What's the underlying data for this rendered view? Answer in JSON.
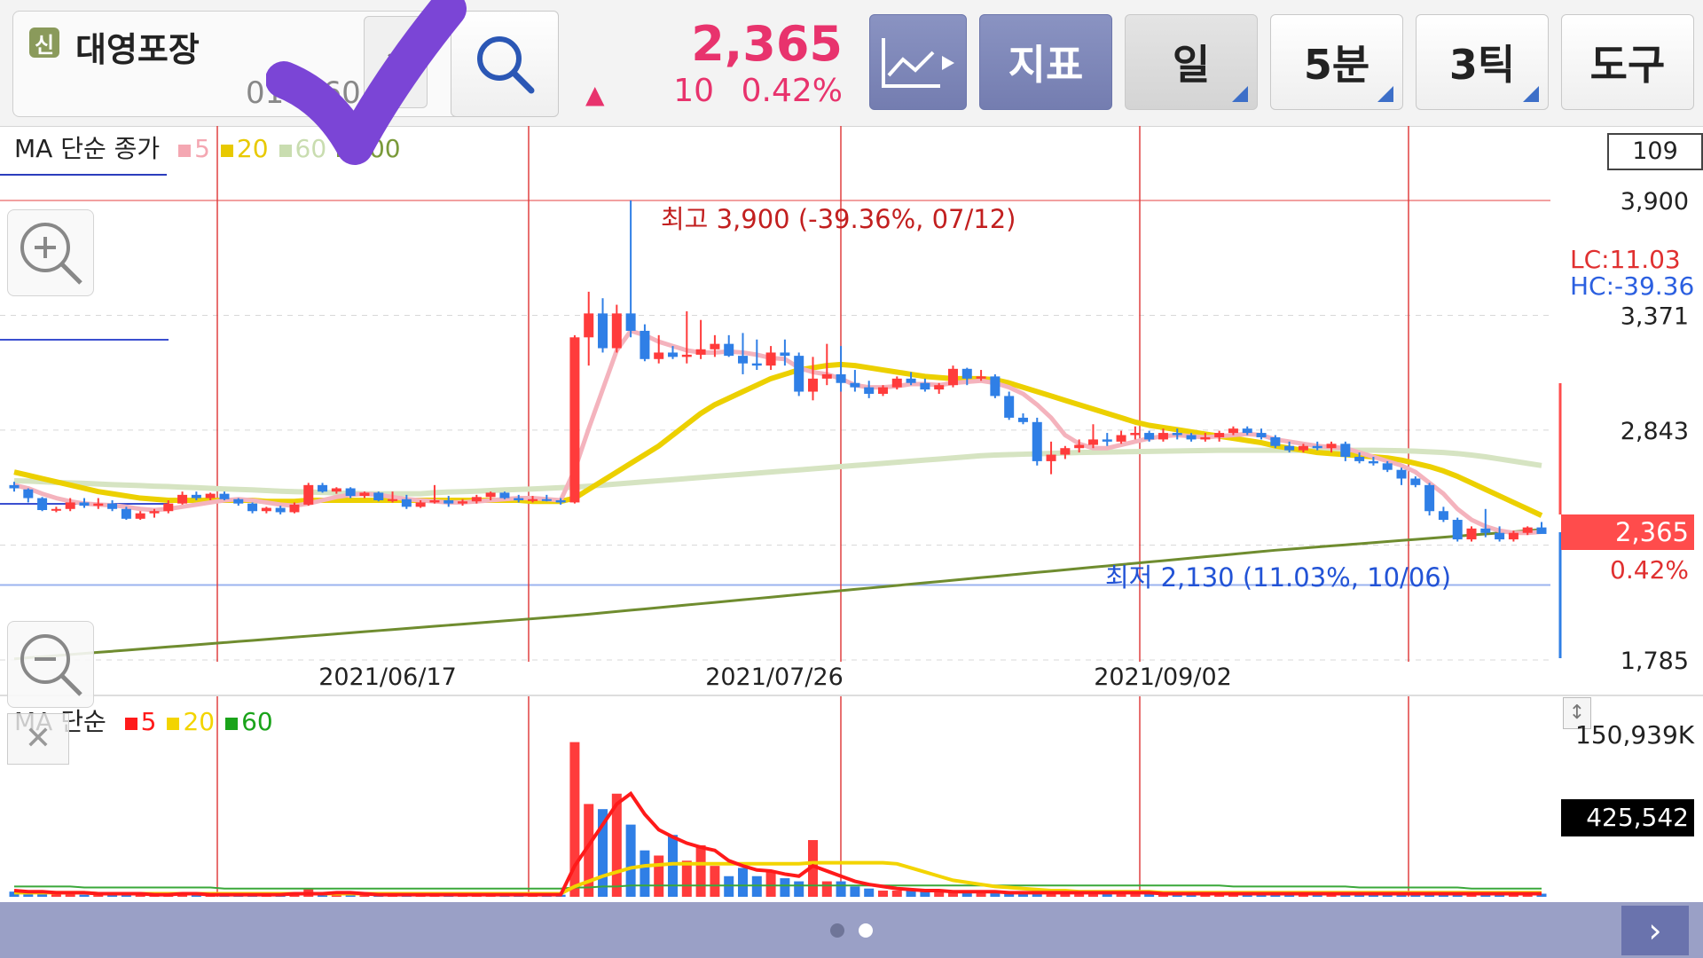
{
  "toolbar": {
    "credit_badge": "신",
    "stock_name": "대영포장",
    "stock_code": "014160",
    "price": "2,365",
    "change_arrow": "▲",
    "change_value": "10",
    "change_percent": "0.42%",
    "buttons": {
      "chart_type": "",
      "indicator": "지표",
      "period_day": "일",
      "period_5min": "5분",
      "period_3tick": "3틱",
      "tools": "도구"
    }
  },
  "main_chart": {
    "legend_title": "MA 단순 종가",
    "legend_items": [
      {
        "label": "5",
        "color": "#f4a7b2"
      },
      {
        "label": "20",
        "color": "#e8c900"
      },
      {
        "label": "60",
        "color": "#c9ddb0"
      },
      {
        "label": "200",
        "color": "#7a9a3a"
      }
    ],
    "count_box": "109",
    "y_ticks": [
      "3,900",
      "3,371",
      "2,843",
      "1,785"
    ],
    "lc_label": "LC:11.03",
    "hc_label": "HC:-39.36",
    "current_price_tag": "2,365",
    "current_pct": "0.42%",
    "high_annotation": "최고 3,900 (-39.36%, 07/12)",
    "low_annotation": "최저 2,130 (11.03%, 10/06)",
    "x_ticks": [
      "2021/06/17",
      "2021/07/26",
      "2021/09/02"
    ]
  },
  "volume_chart": {
    "legend_title": "MA 단순",
    "legend_items": [
      {
        "label": "5",
        "color": "#ff1a1a"
      },
      {
        "label": "20",
        "color": "#f3d400"
      },
      {
        "label": "60",
        "color": "#1aa31a"
      }
    ],
    "max_label": "150,939K",
    "current_volume": "425,542"
  },
  "chart_data": {
    "type": "candlestick",
    "y_range": [
      1785,
      3900
    ],
    "price_high": 3900,
    "price_low": 2130,
    "current": 2365,
    "x_tick_dates": [
      "2021/06/17",
      "2021/07/26",
      "2021/09/02"
    ],
    "candles": [
      [
        2590,
        2605,
        2560,
        2575
      ],
      [
        2570,
        2575,
        2510,
        2530
      ],
      [
        2530,
        2535,
        2470,
        2475
      ],
      [
        2475,
        2490,
        2465,
        2480
      ],
      [
        2480,
        2530,
        2470,
        2510
      ],
      [
        2510,
        2530,
        2485,
        2495
      ],
      [
        2495,
        2530,
        2480,
        2505
      ],
      [
        2505,
        2520,
        2470,
        2480
      ],
      [
        2480,
        2490,
        2430,
        2435
      ],
      [
        2435,
        2470,
        2430,
        2460
      ],
      [
        2460,
        2480,
        2440,
        2470
      ],
      [
        2470,
        2520,
        2460,
        2505
      ],
      [
        2505,
        2560,
        2500,
        2545
      ],
      [
        2545,
        2560,
        2520,
        2530
      ],
      [
        2530,
        2555,
        2520,
        2550
      ],
      [
        2550,
        2560,
        2520,
        2525
      ],
      [
        2525,
        2530,
        2495,
        2505
      ],
      [
        2505,
        2510,
        2460,
        2470
      ],
      [
        2470,
        2490,
        2460,
        2485
      ],
      [
        2485,
        2495,
        2455,
        2465
      ],
      [
        2465,
        2510,
        2460,
        2500
      ],
      [
        2500,
        2600,
        2495,
        2590
      ],
      [
        2590,
        2600,
        2555,
        2560
      ],
      [
        2560,
        2580,
        2550,
        2575
      ],
      [
        2575,
        2580,
        2530,
        2540
      ],
      [
        2540,
        2560,
        2530,
        2555
      ],
      [
        2555,
        2560,
        2515,
        2520
      ],
      [
        2520,
        2560,
        2510,
        2525
      ],
      [
        2525,
        2545,
        2480,
        2490
      ],
      [
        2490,
        2520,
        2485,
        2510
      ],
      [
        2510,
        2590,
        2505,
        2520
      ],
      [
        2520,
        2540,
        2490,
        2505
      ],
      [
        2505,
        2525,
        2495,
        2515
      ],
      [
        2515,
        2545,
        2505,
        2535
      ],
      [
        2535,
        2560,
        2520,
        2555
      ],
      [
        2555,
        2560,
        2525,
        2530
      ],
      [
        2530,
        2545,
        2510,
        2520
      ],
      [
        2520,
        2540,
        2510,
        2525
      ],
      [
        2525,
        2545,
        2515,
        2520
      ],
      [
        2520,
        2530,
        2500,
        2510
      ],
      [
        2510,
        3280,
        2505,
        3270
      ],
      [
        3270,
        3480,
        3140,
        3380
      ],
      [
        3380,
        3450,
        3200,
        3220
      ],
      [
        3220,
        3420,
        3200,
        3380
      ],
      [
        3380,
        3900,
        3270,
        3300
      ],
      [
        3300,
        3330,
        3160,
        3170
      ],
      [
        3170,
        3280,
        3150,
        3200
      ],
      [
        3200,
        3230,
        3170,
        3180
      ],
      [
        3180,
        3390,
        3150,
        3190
      ],
      [
        3190,
        3350,
        3170,
        3215
      ],
      [
        3215,
        3280,
        3180,
        3240
      ],
      [
        3240,
        3280,
        3180,
        3185
      ],
      [
        3185,
        3290,
        3100,
        3150
      ],
      [
        3150,
        3260,
        3120,
        3140
      ],
      [
        3140,
        3230,
        3120,
        3200
      ],
      [
        3200,
        3260,
        3140,
        3185
      ],
      [
        3185,
        3200,
        3000,
        3020
      ],
      [
        3020,
        3180,
        2980,
        3080
      ],
      [
        3080,
        3240,
        3050,
        3100
      ],
      [
        3100,
        3230,
        3020,
        3060
      ],
      [
        3060,
        3120,
        3020,
        3040
      ],
      [
        3040,
        3070,
        2990,
        3010
      ],
      [
        3010,
        3050,
        3000,
        3040
      ],
      [
        3040,
        3090,
        3030,
        3080
      ],
      [
        3080,
        3110,
        3050,
        3060
      ],
      [
        3060,
        3080,
        3020,
        3030
      ],
      [
        3030,
        3060,
        3010,
        3050
      ],
      [
        3050,
        3140,
        3040,
        3125
      ],
      [
        3125,
        3130,
        3050,
        3080
      ],
      [
        3080,
        3120,
        3070,
        3090
      ],
      [
        3090,
        3100,
        2990,
        3000
      ],
      [
        3000,
        3020,
        2890,
        2900
      ],
      [
        2900,
        2920,
        2870,
        2880
      ],
      [
        2880,
        2900,
        2680,
        2700
      ],
      [
        2700,
        2790,
        2640,
        2730
      ],
      [
        2730,
        2770,
        2710,
        2760
      ],
      [
        2760,
        2800,
        2740,
        2775
      ],
      [
        2775,
        2870,
        2760,
        2800
      ],
      [
        2800,
        2830,
        2770,
        2790
      ],
      [
        2790,
        2840,
        2780,
        2820
      ],
      [
        2820,
        2860,
        2800,
        2830
      ],
      [
        2830,
        2840,
        2790,
        2800
      ],
      [
        2800,
        2850,
        2790,
        2830
      ],
      [
        2830,
        2850,
        2800,
        2820
      ],
      [
        2820,
        2830,
        2790,
        2800
      ],
      [
        2800,
        2830,
        2790,
        2810
      ],
      [
        2810,
        2840,
        2790,
        2830
      ],
      [
        2830,
        2860,
        2820,
        2850
      ],
      [
        2850,
        2860,
        2820,
        2830
      ],
      [
        2830,
        2850,
        2800,
        2810
      ],
      [
        2810,
        2820,
        2760,
        2770
      ],
      [
        2770,
        2790,
        2740,
        2750
      ],
      [
        2750,
        2780,
        2740,
        2770
      ],
      [
        2770,
        2790,
        2750,
        2760
      ],
      [
        2760,
        2790,
        2740,
        2780
      ],
      [
        2780,
        2790,
        2700,
        2720
      ],
      [
        2720,
        2740,
        2690,
        2700
      ],
      [
        2700,
        2720,
        2680,
        2690
      ],
      [
        2690,
        2700,
        2650,
        2660
      ],
      [
        2660,
        2670,
        2590,
        2620
      ],
      [
        2620,
        2630,
        2580,
        2590
      ],
      [
        2590,
        2600,
        2450,
        2470
      ],
      [
        2470,
        2490,
        2420,
        2430
      ],
      [
        2430,
        2440,
        2330,
        2340
      ],
      [
        2340,
        2400,
        2330,
        2390
      ],
      [
        2390,
        2480,
        2350,
        2370
      ],
      [
        2370,
        2400,
        2330,
        2340
      ],
      [
        2340,
        2380,
        2330,
        2370
      ],
      [
        2370,
        2400,
        2360,
        2395
      ],
      [
        2395,
        2420,
        2370,
        2365
      ]
    ],
    "ma5": [
      2590,
      2575,
      2550,
      2530,
      2515,
      2505,
      2500,
      2497,
      2490,
      2480,
      2475,
      2480,
      2490,
      2500,
      2510,
      2520,
      2525,
      2520,
      2510,
      2500,
      2495,
      2505,
      2520,
      2535,
      2545,
      2550,
      2545,
      2535,
      2525,
      2520,
      2515,
      2510,
      2510,
      2515,
      2520,
      2525,
      2530,
      2530,
      2525,
      2520,
      2660,
      2850,
      3030,
      3210,
      3300,
      3280,
      3250,
      3230,
      3210,
      3200,
      3200,
      3205,
      3200,
      3190,
      3175,
      3170,
      3130,
      3110,
      3100,
      3080,
      3050,
      3040,
      3040,
      3045,
      3055,
      3055,
      3050,
      3060,
      3065,
      3070,
      3060,
      3040,
      3010,
      2960,
      2900,
      2820,
      2780,
      2760,
      2760,
      2775,
      2790,
      2805,
      2815,
      2820,
      2815,
      2810,
      2815,
      2820,
      2825,
      2820,
      2800,
      2790,
      2780,
      2770,
      2765,
      2760,
      2740,
      2720,
      2700,
      2680,
      2650,
      2600,
      2550,
      2480,
      2430,
      2400,
      2380,
      2370,
      2370,
      2375
    ],
    "ma20": [
      2650,
      2635,
      2620,
      2605,
      2590,
      2575,
      2560,
      2550,
      2540,
      2530,
      2525,
      2520,
      2520,
      2520,
      2520,
      2520,
      2520,
      2520,
      2515,
      2515,
      2515,
      2520,
      2520,
      2520,
      2520,
      2520,
      2520,
      2520,
      2520,
      2520,
      2520,
      2520,
      2520,
      2520,
      2520,
      2520,
      2520,
      2515,
      2515,
      2515,
      2530,
      2570,
      2610,
      2650,
      2690,
      2730,
      2770,
      2820,
      2870,
      2920,
      2960,
      2990,
      3020,
      3050,
      3080,
      3100,
      3120,
      3130,
      3140,
      3145,
      3140,
      3130,
      3120,
      3110,
      3100,
      3090,
      3085,
      3080,
      3080,
      3080,
      3075,
      3060,
      3040,
      3020,
      3000,
      2980,
      2960,
      2940,
      2920,
      2900,
      2880,
      2865,
      2855,
      2845,
      2835,
      2825,
      2815,
      2805,
      2795,
      2785,
      2770,
      2760,
      2750,
      2740,
      2735,
      2730,
      2725,
      2720,
      2715,
      2705,
      2690,
      2675,
      2655,
      2630,
      2600,
      2570,
      2540,
      2510,
      2480,
      2450
    ],
    "ma60": [
      2610,
      2608,
      2605,
      2602,
      2600,
      2598,
      2595,
      2592,
      2590,
      2588,
      2585,
      2583,
      2580,
      2578,
      2575,
      2572,
      2570,
      2568,
      2565,
      2562,
      2560,
      2558,
      2556,
      2554,
      2552,
      2550,
      2550,
      2550,
      2550,
      2550,
      2555,
      2558,
      2560,
      2562,
      2565,
      2568,
      2570,
      2572,
      2575,
      2578,
      2580,
      2585,
      2590,
      2595,
      2600,
      2605,
      2610,
      2615,
      2620,
      2625,
      2630,
      2635,
      2640,
      2645,
      2650,
      2655,
      2660,
      2665,
      2670,
      2675,
      2680,
      2685,
      2690,
      2695,
      2700,
      2705,
      2710,
      2715,
      2720,
      2725,
      2728,
      2730,
      2732,
      2734,
      2736,
      2738,
      2740,
      2741,
      2742,
      2743,
      2744,
      2745,
      2746,
      2747,
      2748,
      2749,
      2750,
      2750,
      2750,
      2750,
      2750,
      2750,
      2750,
      2750,
      2750,
      2750,
      2750,
      2750,
      2749,
      2748,
      2746,
      2743,
      2740,
      2735,
      2728,
      2720,
      2710,
      2700,
      2690,
      2680
    ],
    "ma200": [
      1790,
      1795,
      1800,
      1805,
      1810,
      1815,
      1820,
      1825,
      1830,
      1835,
      1840,
      1845,
      1850,
      1855,
      1860,
      1865,
      1870,
      1875,
      1880,
      1885,
      1890,
      1895,
      1900,
      1905,
      1910,
      1915,
      1920,
      1925,
      1930,
      1935,
      1940,
      1945,
      1950,
      1955,
      1960,
      1965,
      1970,
      1975,
      1980,
      1985,
      1990,
      1996,
      2002,
      2008,
      2014,
      2020,
      2026,
      2032,
      2038,
      2044,
      2050,
      2056,
      2062,
      2068,
      2074,
      2080,
      2086,
      2092,
      2098,
      2104,
      2110,
      2116,
      2122,
      2128,
      2134,
      2140,
      2146,
      2152,
      2158,
      2164,
      2170,
      2176,
      2182,
      2188,
      2194,
      2200,
      2206,
      2212,
      2218,
      2224,
      2230,
      2236,
      2242,
      2248,
      2254,
      2260,
      2266,
      2272,
      2278,
      2284,
      2290,
      2295,
      2300,
      2305,
      2310,
      2315,
      2320,
      2325,
      2330,
      2335,
      2340,
      2345,
      2350,
      2355,
      2360,
      2365,
      2370,
      2375,
      2380,
      2385
    ],
    "volume": [
      5,
      4,
      3,
      3,
      3,
      2,
      3,
      2,
      3,
      2,
      2,
      3,
      3,
      2,
      2,
      2,
      2,
      2,
      2,
      2,
      3,
      8,
      3,
      2,
      2,
      2,
      2,
      2,
      2,
      2,
      3,
      2,
      2,
      2,
      2,
      2,
      2,
      2,
      2,
      2,
      150,
      90,
      85,
      100,
      70,
      45,
      40,
      60,
      35,
      50,
      30,
      20,
      28,
      20,
      25,
      18,
      15,
      55,
      15,
      15,
      10,
      8,
      6,
      6,
      6,
      6,
      5,
      5,
      5,
      5,
      4,
      4,
      5,
      4,
      4,
      4,
      3,
      4,
      4,
      4,
      4,
      3,
      3,
      3,
      3,
      3,
      3,
      3,
      3,
      3,
      3,
      3,
      3,
      3,
      3,
      3,
      3,
      3,
      3,
      3,
      3,
      3,
      3,
      3,
      3,
      3,
      3,
      3,
      3,
      3
    ],
    "vol_ma5": [
      6,
      5,
      5,
      4,
      4,
      4,
      3,
      3,
      3,
      3,
      2,
      2,
      3,
      3,
      2,
      2,
      2,
      2,
      2,
      2,
      3,
      3,
      3,
      4,
      4,
      3,
      2,
      2,
      2,
      2,
      2,
      2,
      2,
      2,
      2,
      2,
      2,
      2,
      2,
      2,
      30,
      50,
      70,
      90,
      100,
      80,
      65,
      58,
      52,
      48,
      45,
      35,
      30,
      26,
      25,
      22,
      20,
      30,
      25,
      20,
      15,
      12,
      10,
      8,
      7,
      6,
      6,
      5,
      5,
      5,
      5,
      4,
      4,
      4,
      4,
      4,
      4,
      4,
      4,
      4,
      4,
      4,
      3,
      3,
      3,
      3,
      3,
      3,
      3,
      3,
      3,
      3,
      3,
      3,
      3,
      3,
      3,
      3,
      3,
      3,
      3,
      3,
      3,
      3,
      3,
      3,
      3,
      3,
      3,
      3
    ],
    "vol_ma20": [
      4,
      4,
      4,
      4,
      4,
      4,
      3,
      3,
      3,
      3,
      3,
      3,
      3,
      3,
      3,
      3,
      3,
      3,
      3,
      3,
      3,
      3,
      3,
      3,
      3,
      3,
      3,
      3,
      3,
      3,
      3,
      3,
      3,
      3,
      3,
      3,
      3,
      3,
      3,
      3,
      10,
      15,
      20,
      24,
      28,
      30,
      31,
      32,
      32,
      32,
      32,
      32,
      32,
      32,
      32,
      32,
      32,
      33,
      33,
      33,
      33,
      33,
      33,
      32,
      28,
      24,
      20,
      16,
      14,
      12,
      10,
      9,
      8,
      7,
      6,
      6,
      5,
      5,
      5,
      5,
      5,
      5,
      4,
      4,
      4,
      4,
      4,
      4,
      4,
      4,
      4,
      4,
      4,
      4,
      4,
      4,
      4,
      4,
      4,
      4,
      4,
      4,
      4,
      4,
      4,
      4,
      4,
      4,
      4,
      4
    ],
    "vol_ma60": [
      10,
      10,
      10,
      10,
      10,
      9,
      9,
      9,
      9,
      9,
      9,
      9,
      9,
      9,
      9,
      8,
      8,
      8,
      8,
      8,
      8,
      8,
      8,
      8,
      8,
      8,
      8,
      8,
      8,
      8,
      8,
      8,
      8,
      8,
      8,
      8,
      8,
      8,
      8,
      8,
      9,
      9,
      10,
      10,
      11,
      11,
      11,
      11,
      11,
      11,
      11,
      11,
      11,
      11,
      11,
      11,
      11,
      11,
      11,
      11,
      11,
      11,
      11,
      11,
      11,
      11,
      11,
      11,
      11,
      11,
      11,
      11,
      11,
      11,
      11,
      11,
      11,
      11,
      11,
      11,
      11,
      11,
      11,
      11,
      11,
      11,
      11,
      10,
      10,
      10,
      10,
      10,
      10,
      10,
      10,
      10,
      9,
      9,
      9,
      9,
      9,
      9,
      9,
      9,
      8,
      8,
      8,
      8,
      8,
      8
    ],
    "vol_max": 160
  },
  "pager": {
    "dots": 2,
    "active": 1
  }
}
